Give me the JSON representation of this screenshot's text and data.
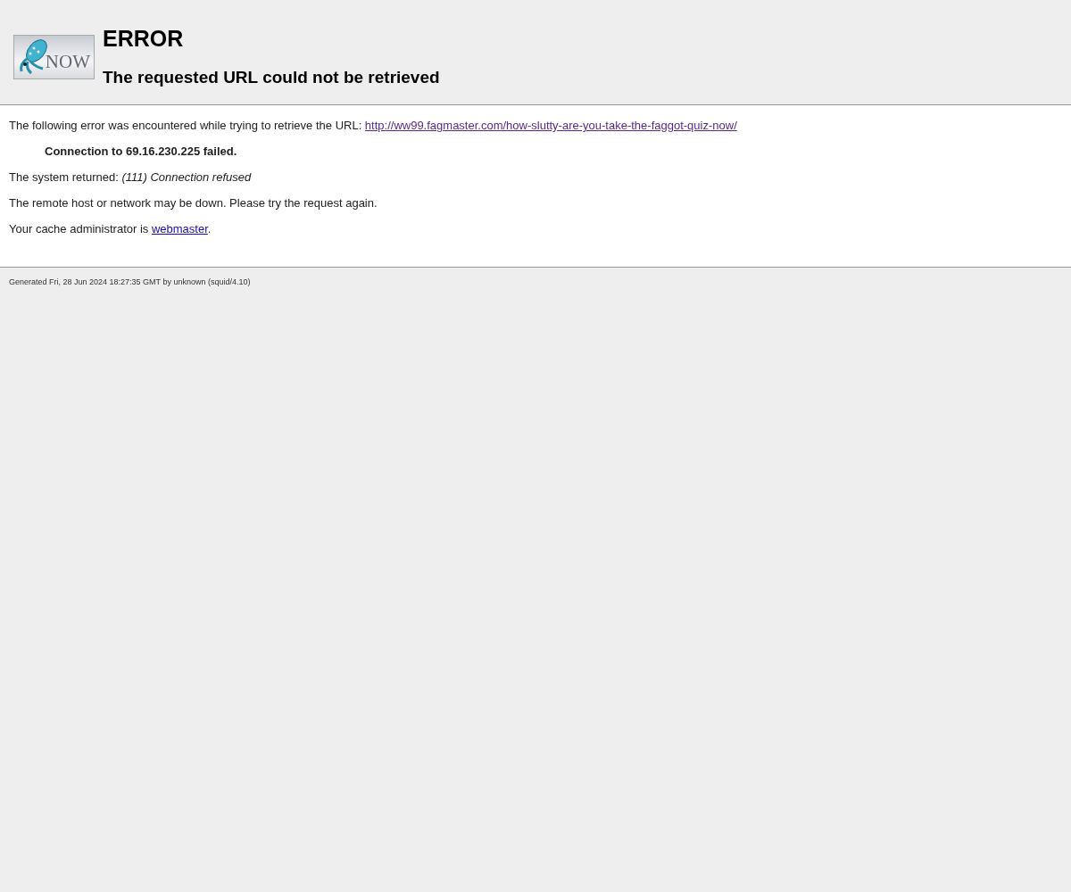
{
  "header": {
    "logo_text": "NOW",
    "title": "ERROR",
    "subtitle": "The requested URL could not be retrieved"
  },
  "content": {
    "intro": {
      "text": "The following error was encountered while trying to retrieve the URL: ",
      "url": "http://ww99.fagmaster.com/how-slutty-are-you-take-the-faggot-quiz-now/"
    },
    "error_detail": "Connection to 69.16.230.225 failed.",
    "system_returned": "The system returned: *(111) Connection refused*",
    "advice": "The remote host or network may be down. Please try the request again.",
    "admin": {
      "text": "Your cache administrator is ",
      "link": "webmaster",
      "after": "."
    }
  },
  "footer": "Generated Fri, 28 Jun 2024 18:27:35 GMT by unknown (squid/4.10)"
}
